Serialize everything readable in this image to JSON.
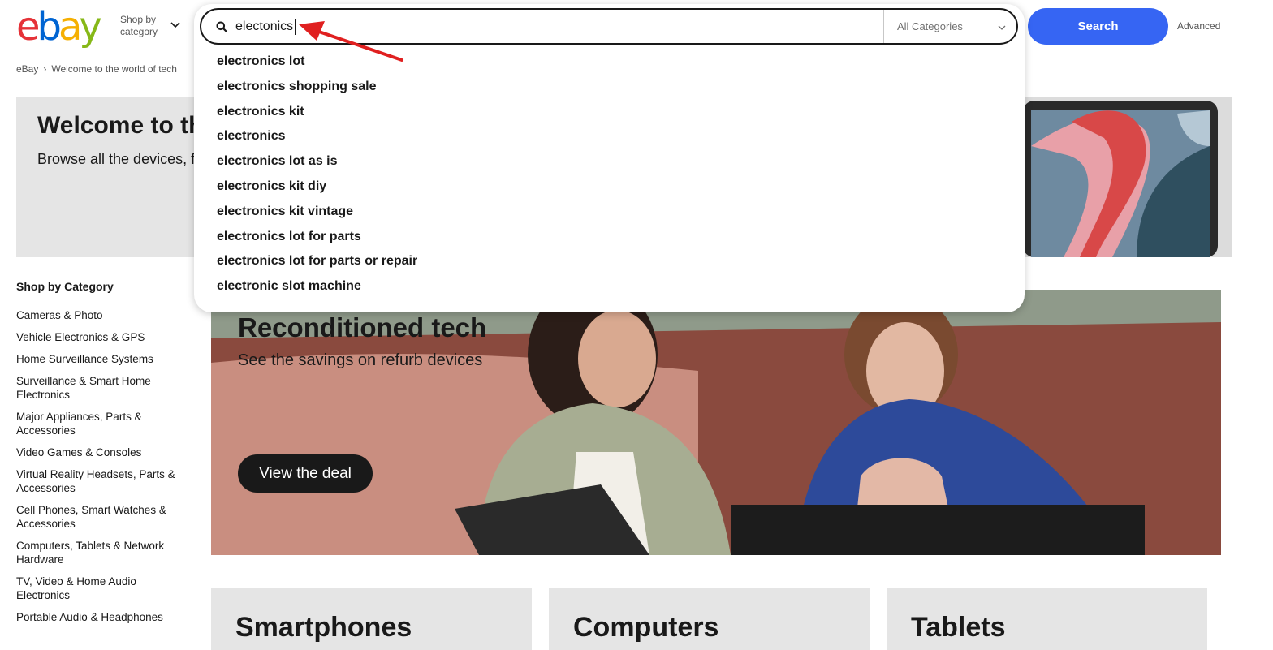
{
  "header": {
    "logo_letters": [
      {
        "ch": "e",
        "color": "#e53238"
      },
      {
        "ch": "b",
        "color": "#0064d2"
      },
      {
        "ch": "a",
        "color": "#f5af02"
      },
      {
        "ch": "y",
        "color": "#86b817"
      }
    ],
    "shop_by_line1": "Shop by",
    "shop_by_line2": "category",
    "search_value": "electonics",
    "category_select": "All Categories",
    "search_button": "Search",
    "advanced_link": "Advanced"
  },
  "breadcrumb": {
    "home": "eBay",
    "separator": "›",
    "current": "Welcome to the world of tech"
  },
  "hero": {
    "title": "Welcome to the world of tech",
    "subtitle": "Browse all the devices, from smartphones to PCs."
  },
  "sidebar": {
    "title": "Shop by Category",
    "items": [
      "Cameras & Photo",
      "Vehicle Electronics & GPS",
      "Home Surveillance Systems",
      "Surveillance & Smart Home Electronics",
      "Major Appliances, Parts & Accessories",
      "Video Games & Consoles",
      "Virtual Reality Headsets, Parts & Accessories",
      "Cell Phones, Smart Watches & Accessories",
      "Computers, Tablets & Network Hardware",
      "TV, Video & Home Audio Electronics",
      "Portable Audio & Headphones"
    ]
  },
  "banner": {
    "title": "Reconditioned tech",
    "subtitle": "See the savings on refurb devices",
    "button": "View the deal"
  },
  "cards": [
    "Smartphones",
    "Computers",
    "Tablets"
  ],
  "suggestions": [
    "electronics lot",
    "electronics shopping sale",
    "electronics kit",
    "electronics",
    "electronics lot as is",
    "electronics kit diy",
    "electronics kit vintage",
    "electronics lot for parts",
    "electronics lot for parts or repair",
    "electronic slot machine"
  ],
  "colors": {
    "search_button": "#3665f3",
    "annotation_arrow": "#e02020"
  }
}
